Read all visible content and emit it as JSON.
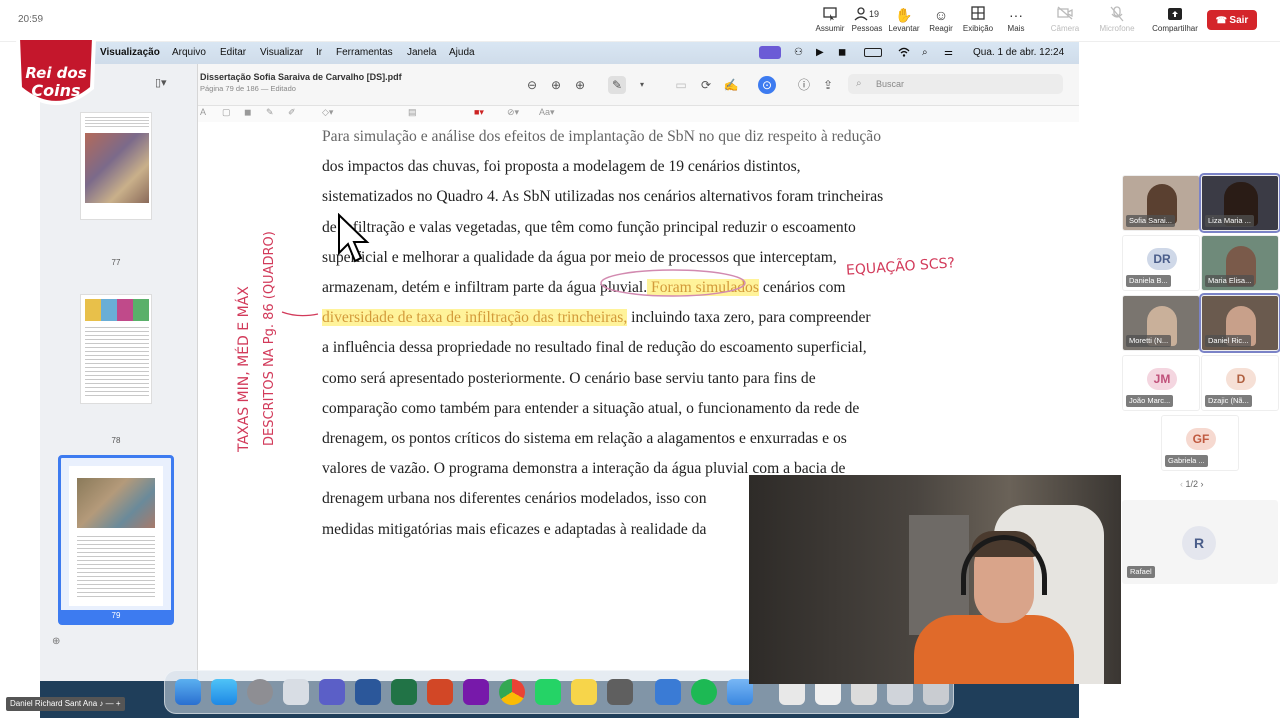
{
  "meeting": {
    "time": "20:59",
    "toolbar": [
      {
        "key": "assumir",
        "label": "Assumir",
        "icon": "take-control-icon"
      },
      {
        "key": "pessoas",
        "label": "Pessoas",
        "icon": "people-icon",
        "count": "19"
      },
      {
        "key": "levantar",
        "label": "Levantar",
        "icon": "raise-hand-icon"
      },
      {
        "key": "reagir",
        "label": "Reagir",
        "icon": "react-icon"
      },
      {
        "key": "exibicao",
        "label": "Exibição",
        "icon": "view-icon"
      },
      {
        "key": "mais",
        "label": "Mais",
        "icon": "more-icon"
      },
      {
        "key": "camera",
        "label": "Câmera",
        "icon": "camera-off-icon"
      },
      {
        "key": "microfone",
        "label": "Microfone",
        "icon": "mic-off-icon"
      },
      {
        "key": "compartilhar",
        "label": "Compartilhar",
        "icon": "share-icon"
      }
    ],
    "leave_label": "Sair",
    "leave_color": "#d4252a"
  },
  "logo": {
    "text_top": "Rei dos",
    "text_bottom": "Coins"
  },
  "mac": {
    "menu": [
      "Visualização",
      "Arquivo",
      "Editar",
      "Visualizar",
      "Ir",
      "Ferramentas",
      "Janela",
      "Ajuda"
    ],
    "clock": "Qua. 1 de abr.  12:24"
  },
  "preview": {
    "title": "Dissertação Sofia Saraiva de Carvalho [DS].pdf",
    "subtitle": "Página 79 de 186 — Editado",
    "search_placeholder": "Buscar",
    "page_labels": [
      "77",
      "78",
      "79"
    ],
    "paragraph": {
      "line1": "Para simulação e análise dos efeitos de implantação de SbN no que diz respeito à redução",
      "line2": "dos impactos das chuvas, foi proposta a modelagem de 19 cenários distintos,",
      "line3": "sistematizados no Quadro 4. As SbN utilizadas nos cenários alternativos foram trincheiras",
      "line4": "de infiltração e valas vegetadas, que têm como função principal reduzir o escoamento",
      "line5": "superficial e melhorar a qualidade da água por meio de processos que interceptam,",
      "line6a": "armazenam, detém e infiltram parte da água pluvial.",
      "line6hl": " Foram simulados",
      "line6b": " cenários com",
      "line7hl": "diversidade de taxa de infiltração das trincheiras,",
      "line7b": " incluindo taxa zero, para compreender",
      "line8": "a influência dessa propriedade no resultado final de redução do escoamento superficial,",
      "line9": "como será apresentado posteriormente. O cenário base serviu tanto para fins de",
      "line10": "comparação como também para entender a situação atual, o funcionamento da rede de",
      "line11": "drenagem, os pontos críticos do sistema em relação a alagamentos e enxurradas e os",
      "line12": "valores de vazão. O programa demonstra a interação da água pluvial com a bacia de",
      "line13": "drenagem urbana nos diferentes cenários modelados, isso con",
      "line14": "medidas mitigatórias mais eficazes e adaptadas à realidade da"
    },
    "annotations": {
      "margin_line1": "TAXAS MIN, MÉD E MÁX",
      "margin_line2": "DESCRITOS NA Pg. 86 (QUADRO)",
      "right_note": "EQUAÇÃO SCS?"
    }
  },
  "participants": [
    {
      "name": "Sofia Sarai...",
      "type": "video",
      "color": "#b9a89a"
    },
    {
      "name": "Liza Maria ...",
      "type": "video",
      "color": "#3b3b45"
    },
    {
      "name": "Daniela B...",
      "type": "initials",
      "initials": "DR",
      "color": "#cfd8e8",
      "text_color": "#4a5d8a"
    },
    {
      "name": "Maria Elisa...",
      "type": "video",
      "color": "#6f8a7a"
    },
    {
      "name": "Moretti (N...",
      "type": "video",
      "color": "#7a756f"
    },
    {
      "name": "Daniel Ric...",
      "type": "video",
      "color": "#6a5a4e",
      "active": true
    },
    {
      "name": "João Marc...",
      "type": "initials",
      "initials": "JM",
      "color": "#f4d6e0",
      "text_color": "#c0507a"
    },
    {
      "name": "Dzajic (Nã...",
      "type": "initials",
      "initials": "D",
      "color": "#f6e0d6",
      "text_color": "#b06040"
    },
    {
      "name": "Gabriela ...",
      "type": "initials",
      "initials": "GF",
      "color": "#f6d9d0",
      "text_color": "#c05a40"
    }
  ],
  "pager": "1/2",
  "extra_participant": {
    "name": "Rafael",
    "initials": "R"
  },
  "self_view_label": "Daniel Richard Sant Ana"
}
